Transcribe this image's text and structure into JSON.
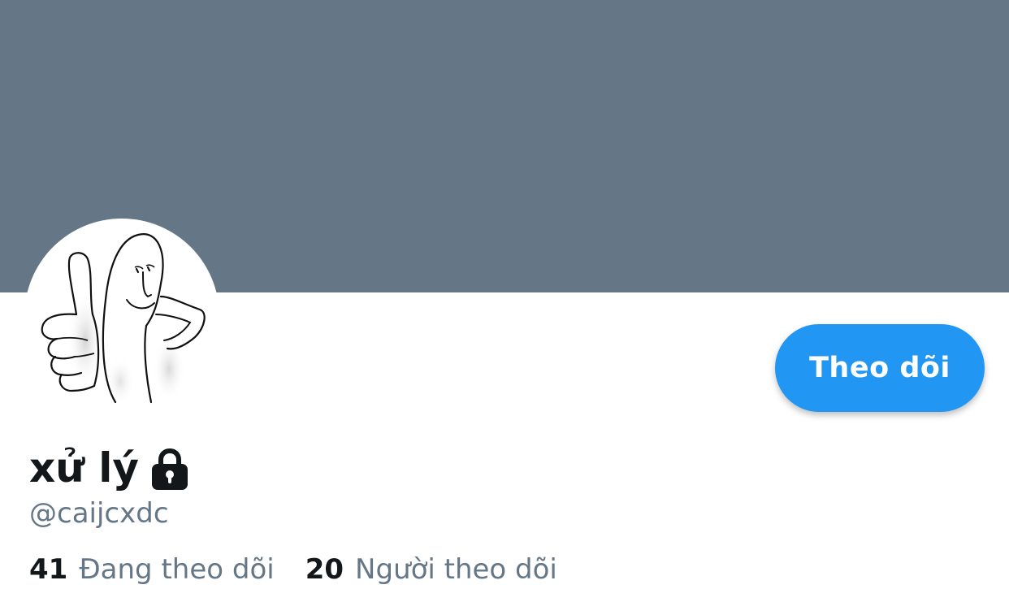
{
  "profile": {
    "banner_color": "#657786",
    "avatar_icon": "thumbs-up-doodle-avatar",
    "display_name": "xử lý",
    "protected_icon": "lock-icon",
    "handle": "@caijcxdc",
    "follow_button": {
      "label": "Theo dõi",
      "color": "#2196F3"
    }
  },
  "stats": {
    "following": {
      "count": "41",
      "label": "Đang theo dõi"
    },
    "followers": {
      "count": "20",
      "label": "Người theo dõi"
    }
  }
}
